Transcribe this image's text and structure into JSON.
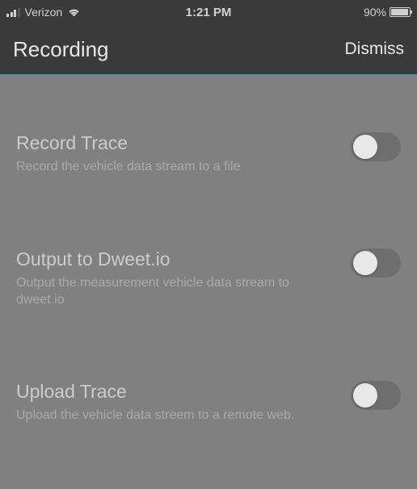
{
  "status_bar": {
    "carrier": "Verizon",
    "time": "1:21 PM",
    "battery_pct": "90%"
  },
  "nav": {
    "title": "Recording",
    "dismiss": "Dismiss"
  },
  "settings": [
    {
      "title": "Record Trace",
      "description": "Record the vehicle data stream to a file",
      "on": false
    },
    {
      "title": "Output to Dweet.io",
      "description": "Output the measurement vehicle data stream to dweet.io",
      "on": false
    },
    {
      "title": "Upload Trace",
      "description": "Upload the vehicle data streem to a remote web.",
      "on": false
    }
  ]
}
